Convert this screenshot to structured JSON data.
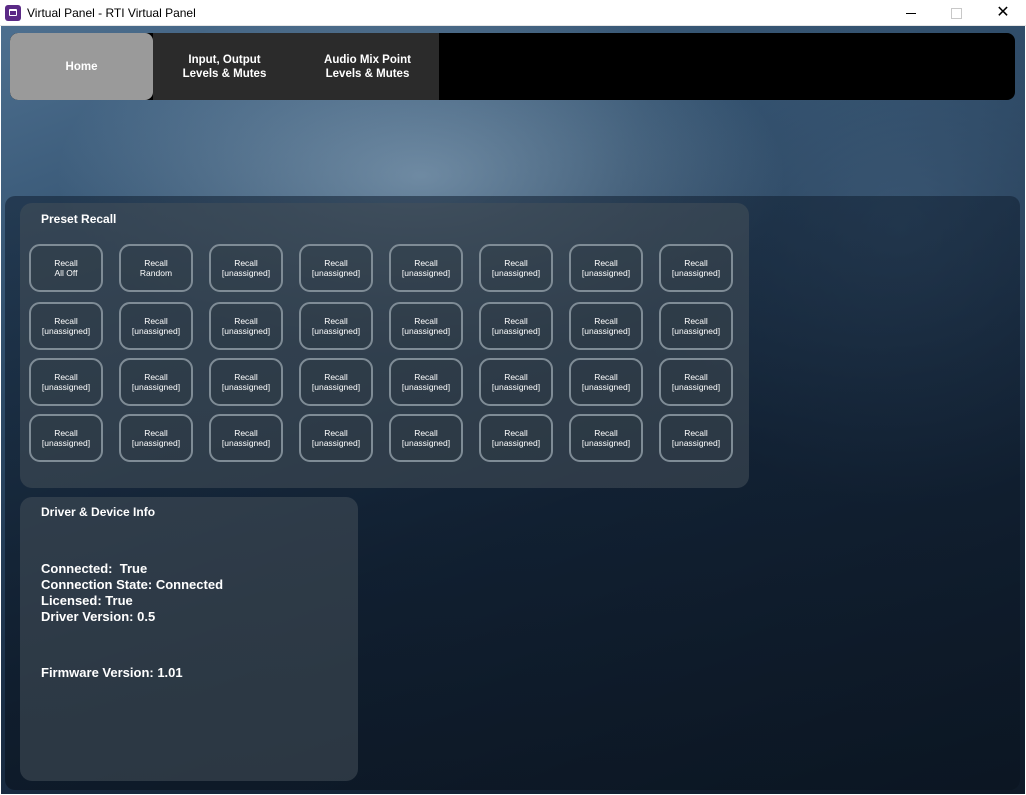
{
  "window": {
    "title": "Virtual Panel - RTI Virtual Panel",
    "minimize_label": "",
    "maximize_label": "",
    "close_label": "✕"
  },
  "nav": {
    "tabs": [
      {
        "line1": "Home",
        "line2": ""
      },
      {
        "line1": "Input, Output",
        "line2": "Levels & Mutes"
      },
      {
        "line1": "Audio Mix Point",
        "line2": "Levels & Mutes"
      }
    ]
  },
  "preset": {
    "title": "Preset Recall",
    "buttons": [
      {
        "line1": "Recall",
        "line2": "All Off"
      },
      {
        "line1": "Recall",
        "line2": "Random"
      },
      {
        "line1": "Recall",
        "line2": "[unassigned]"
      },
      {
        "line1": "Recall",
        "line2": "[unassigned]"
      },
      {
        "line1": "Recall",
        "line2": "[unassigned]"
      },
      {
        "line1": "Recall",
        "line2": "[unassigned]"
      },
      {
        "line1": "Recall",
        "line2": "[unassigned]"
      },
      {
        "line1": "Recall",
        "line2": "[unassigned]"
      },
      {
        "line1": "Recall",
        "line2": "[unassigned]"
      },
      {
        "line1": "Recall",
        "line2": "[unassigned]"
      },
      {
        "line1": "Recall",
        "line2": "[unassigned]"
      },
      {
        "line1": "Recall",
        "line2": "[unassigned]"
      },
      {
        "line1": "Recall",
        "line2": "[unassigned]"
      },
      {
        "line1": "Recall",
        "line2": "[unassigned]"
      },
      {
        "line1": "Recall",
        "line2": "[unassigned]"
      },
      {
        "line1": "Recall",
        "line2": "[unassigned]"
      },
      {
        "line1": "Recall",
        "line2": "[unassigned]"
      },
      {
        "line1": "Recall",
        "line2": "[unassigned]"
      },
      {
        "line1": "Recall",
        "line2": "[unassigned]"
      },
      {
        "line1": "Recall",
        "line2": "[unassigned]"
      },
      {
        "line1": "Recall",
        "line2": "[unassigned]"
      },
      {
        "line1": "Recall",
        "line2": "[unassigned]"
      },
      {
        "line1": "Recall",
        "line2": "[unassigned]"
      },
      {
        "line1": "Recall",
        "line2": "[unassigned]"
      },
      {
        "line1": "Recall",
        "line2": "[unassigned]"
      },
      {
        "line1": "Recall",
        "line2": "[unassigned]"
      },
      {
        "line1": "Recall",
        "line2": "[unassigned]"
      },
      {
        "line1": "Recall",
        "line2": "[unassigned]"
      },
      {
        "line1": "Recall",
        "line2": "[unassigned]"
      },
      {
        "line1": "Recall",
        "line2": "[unassigned]"
      },
      {
        "line1": "Recall",
        "line2": "[unassigned]"
      },
      {
        "line1": "Recall",
        "line2": "[unassigned]"
      }
    ]
  },
  "info": {
    "title": "Driver & Device Info",
    "connected": "Connected:  True",
    "connection_state": "Connection State: Connected",
    "licensed": "Licensed: True",
    "driver_version": "Driver Version: 0.5",
    "firmware_version": "Firmware Version: 1.01"
  },
  "colors": {
    "app_icon": "#5b2a86",
    "nav_active": "#9a9a9a",
    "nav_inactive": "#2b2b2b",
    "button_border": "#7f8c96"
  }
}
